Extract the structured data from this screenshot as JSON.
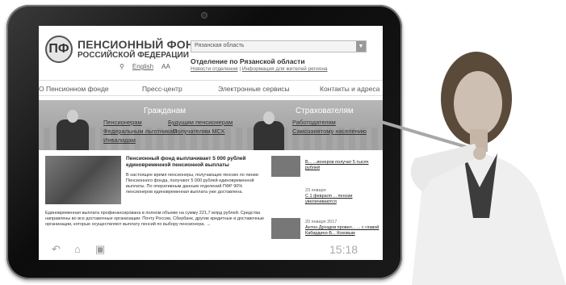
{
  "device": {
    "clock": "15:18",
    "nav_icons": [
      "back-icon",
      "home-icon",
      "recent-apps-icon"
    ]
  },
  "header": {
    "org_line1": "ПЕНСИОННЫЙ ФОНД",
    "org_line2": "РОССИЙСКОЙ ФЕДЕРАЦИИ",
    "lang": "English",
    "font_size": "AA",
    "region_select": "Рязанская область",
    "department": "Отделение по Рязанской области",
    "dept_link1": "Новости отделения",
    "dept_link2": "Информация для жителей региона"
  },
  "main_nav": [
    "О Пенсионном фонде",
    "Пресс-центр",
    "Электронные сервисы",
    "Контакты и адреса"
  ],
  "banner": {
    "citizens_title": "Гражданам",
    "citizens_links": [
      "Пенсионерам",
      "Будущим пенсионерам",
      "Федеральным льготникам",
      "Получателям МСК",
      "Инвалидам"
    ],
    "insurers_title": "Страхователям",
    "insurers_links": [
      "Работодателям",
      "Самозанятому населению"
    ]
  },
  "news": {
    "title": "Пенсионный фонд выплачивает 5 000 рублей единовременной пенсионной выплаты",
    "text": "В настоящее время пенсионеры, получающие пенсию по линии Пенсионного фонда, получают 5 000 рублей единовременной выплаты. По оперативным данным отделений ПФР 90% пенсионеров единовременная выплата уже доставлена.",
    "full": "Единовременная выплата профинансирована в полном объеме на сумму 221,7 млрд рублей. Средства направлены во все доставочные организации: Почту России, Сбербанк, другие кредитные и доставочные организации, которые осуществляют выплату пенсий по выбору пенсионера. →"
  },
  "side_news": [
    {
      "date": "",
      "title": "В... ...ионеров получат 5 тысяч рублей"
    },
    {
      "date": "23 января",
      "title": "С 1 февраля ... пенсии увеличиваются"
    },
    {
      "date": "20 января 2017",
      "title": "Антон Дроздов провел... ... с главой Кабардино-Б... Коковым"
    }
  ]
}
